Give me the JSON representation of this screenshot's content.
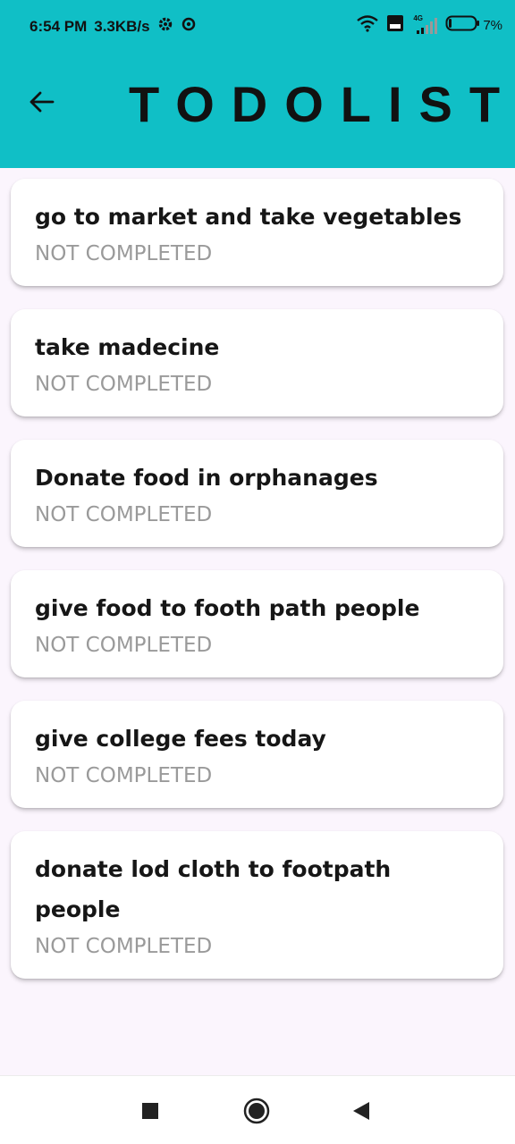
{
  "status_bar": {
    "time": "6:54 PM",
    "speed": "3.3KB/s",
    "network_tag": "4G",
    "battery": "7%"
  },
  "header": {
    "title": "TODOLIST"
  },
  "todos": [
    {
      "title": "go to market and take vegetables",
      "status": "NOT COMPLETED"
    },
    {
      "title": "take madecine",
      "status": "NOT COMPLETED"
    },
    {
      "title": "Donate food in orphanages",
      "status": "NOT COMPLETED"
    },
    {
      "title": "give food to footh path people",
      "status": "NOT COMPLETED"
    },
    {
      "title": "give college fees today",
      "status": "NOT COMPLETED"
    },
    {
      "title": "donate lod cloth to footpath people",
      "status": "NOT COMPLETED"
    }
  ],
  "colors": {
    "appbar": "#10bfc6",
    "background": "#fbf5fd",
    "status_text": "#9a9a9a"
  }
}
